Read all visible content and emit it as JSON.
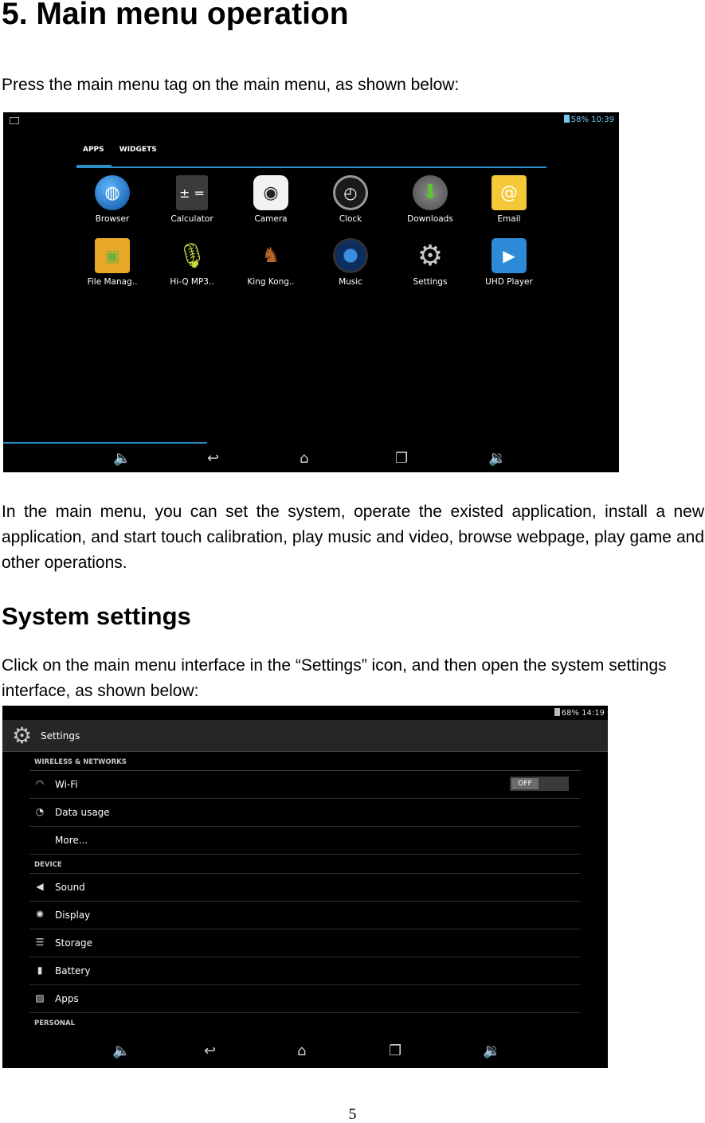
{
  "heading": "5. Main menu operation",
  "intro": "Press the main menu tag on the main menu, as shown below:",
  "screenshot1": {
    "status_right": "58%  10:39",
    "tabs": [
      "APPS",
      "WIDGETS"
    ],
    "apps": [
      {
        "label": "Browser",
        "icon": "globe-icon"
      },
      {
        "label": "Calculator",
        "icon": "calculator-icon"
      },
      {
        "label": "Camera",
        "icon": "camera-icon"
      },
      {
        "label": "Clock",
        "icon": "clock-icon"
      },
      {
        "label": "Downloads",
        "icon": "download-icon"
      },
      {
        "label": "Email",
        "icon": "email-icon"
      },
      {
        "label": "File Manag..",
        "icon": "folder-icon"
      },
      {
        "label": "Hi-Q MP3..",
        "icon": "microphone-icon"
      },
      {
        "label": "King Kong..",
        "icon": "game-icon"
      },
      {
        "label": "Music",
        "icon": "speaker-icon"
      },
      {
        "label": "Settings",
        "icon": "gear-icon"
      },
      {
        "label": "UHD Player",
        "icon": "clapper-icon"
      }
    ]
  },
  "para1": "In the main menu, you can set the system, operate the existed application, install a new application, and start touch calibration, play music and video, browse webpage, play game and other operations.",
  "subheading": "System settings",
  "para2": "Click on the main menu interface in the “Settings” icon, and then open the system settings interface, as shown below:",
  "screenshot2": {
    "status_right": "68%  14:19",
    "title": "Settings",
    "sections": {
      "wireless": "WIRELESS & NETWORKS",
      "device": "DEVICE",
      "personal": "PERSONAL"
    },
    "wireless_items": [
      "Wi-Fi",
      "Data usage",
      "More..."
    ],
    "device_items": [
      "Sound",
      "Display",
      "Storage",
      "Battery",
      "Apps"
    ],
    "wifi_toggle": "OFF"
  },
  "page_number": "5"
}
